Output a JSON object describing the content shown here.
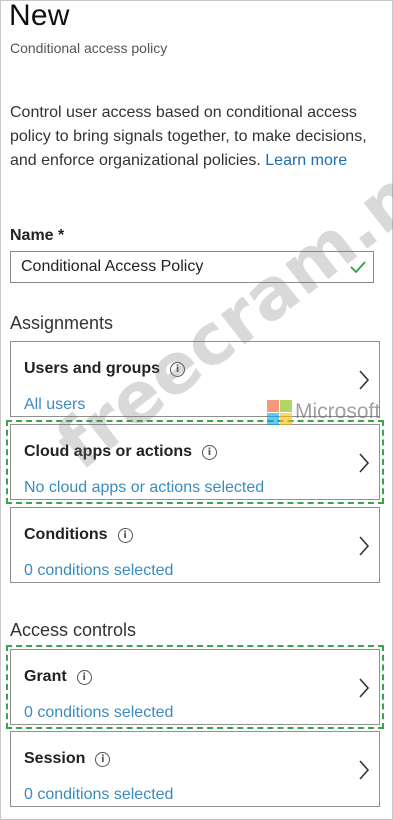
{
  "header": {
    "title": "New",
    "subtitle": "Conditional access policy"
  },
  "description": {
    "text": "Control user access based on conditional access policy to bring signals together, to make decisions, and enforce organizational policies.",
    "link": "Learn more"
  },
  "name_field": {
    "label": "Name *",
    "value": "Conditional Access Policy",
    "valid_icon": "check-icon"
  },
  "assignments": {
    "heading": "Assignments",
    "cards": [
      {
        "title": "Users and groups",
        "value": "All users"
      },
      {
        "title": "Cloud apps or actions",
        "value": "No cloud apps or actions selected"
      },
      {
        "title": "Conditions",
        "value": "0 conditions selected"
      }
    ]
  },
  "access_controls": {
    "heading": "Access controls",
    "cards": [
      {
        "title": "Grant",
        "value": "0 conditions selected"
      },
      {
        "title": "Session",
        "value": "0 conditions selected"
      }
    ]
  },
  "watermark": {
    "text": "freecram.net",
    "brand": "Microsoft"
  },
  "colors": {
    "link": "#1a6fb4",
    "value_text": "#3a8bbf",
    "highlight_dash": "#3aa648",
    "valid_check": "#2e9e44"
  }
}
